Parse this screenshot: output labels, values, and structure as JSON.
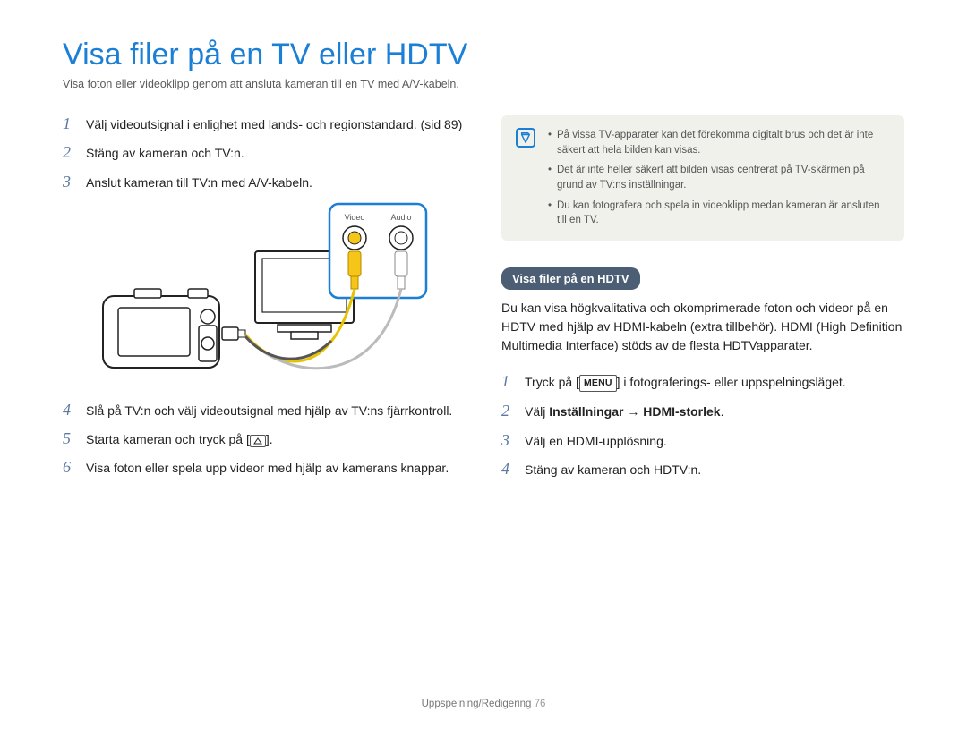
{
  "page": {
    "title": "Visa filer på en TV eller HDTV",
    "subtitle": "Visa foton eller videoklipp genom att ansluta kameran till en TV med A/V-kabeln.",
    "footer_section": "Uppspelning/Redigering",
    "page_number": "76"
  },
  "diagram": {
    "label_video": "Video",
    "label_audio": "Audio"
  },
  "left_steps": [
    {
      "num": "1",
      "text": "Välj videoutsignal i enlighet med lands- och regionstandard. (sid 89)"
    },
    {
      "num": "2",
      "text": "Stäng av kameran och TV:n."
    },
    {
      "num": "3",
      "text": "Anslut kameran till TV:n med A/V-kabeln."
    },
    {
      "num": "4",
      "text": "Slå på TV:n och välj videoutsignal med hjälp av TV:ns fjärrkontroll."
    },
    {
      "num": "5",
      "prefix": "Starta kameran och tryck på [",
      "suffix": "]."
    },
    {
      "num": "6",
      "text": "Visa foton eller spela upp videor med hjälp av kamerans knappar."
    }
  ],
  "notes": [
    "På vissa TV-apparater kan det förekomma digitalt brus och det är inte säkert att hela bilden kan visas.",
    "Det är inte heller säkert att bilden visas centrerat på TV-skärmen på grund av TV:ns inställningar.",
    "Du kan fotografera och spela in videoklipp medan kameran är ansluten till en TV."
  ],
  "hdtv": {
    "pill": "Visa filer på en HDTV",
    "intro": "Du kan visa högkvalitativa och okomprimerade foton och videor på en HDTV med hjälp av HDMI-kabeln (extra tillbehör). HDMI (High Definition Multimedia Interface) stöds av de flesta HDTVapparater.",
    "menu_label": "MENU",
    "steps": [
      {
        "num": "1",
        "prefix": "Tryck på [",
        "suffix": "] i fotograferings- eller uppspelningsläget."
      },
      {
        "num": "2",
        "prefix": "Välj ",
        "bold": "Inställningar → HDMI-storlek",
        "suffix": "."
      },
      {
        "num": "3",
        "text": "Välj en HDMI-upplösning."
      },
      {
        "num": "4",
        "text": "Stäng av kameran och HDTV:n."
      }
    ]
  },
  "chart_data": null
}
